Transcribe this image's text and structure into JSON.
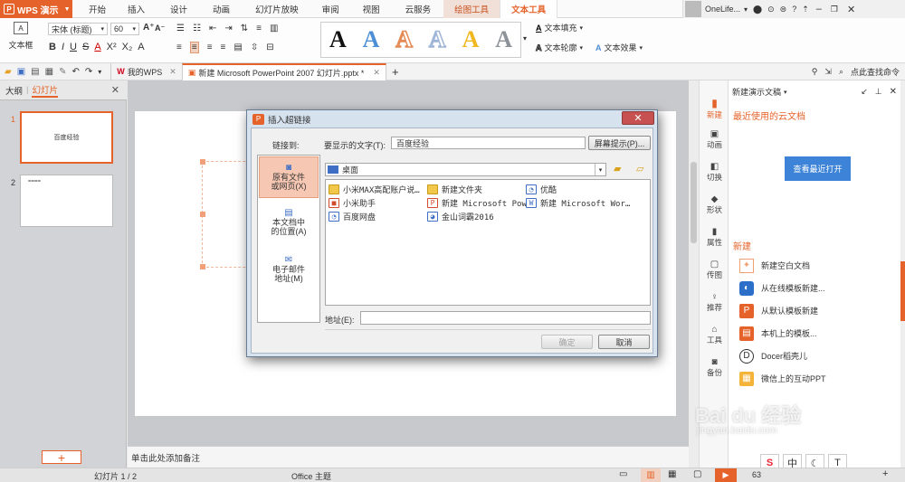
{
  "app": {
    "name": "WPS 演示",
    "logo": "P"
  },
  "menu": {
    "tabs": [
      "开始",
      "插入",
      "设计",
      "动画",
      "幻灯片放映",
      "审阅",
      "视图",
      "云服务",
      "绘图工具",
      "文本工具"
    ],
    "active": "文本工具",
    "context": "绘图工具"
  },
  "account": {
    "name": "OneLife..."
  },
  "ribbon": {
    "textbox": "文本框",
    "font": "宋体 (标题)",
    "size": "60",
    "bold": "B",
    "italic": "I",
    "underline": "U",
    "strike": "S",
    "fill": "文本填充",
    "outline": "文本轮廓",
    "effect": "文本效果",
    "wordart": [
      {
        "letter": "A",
        "color": "#111111"
      },
      {
        "letter": "A",
        "color": "#4d8fd6"
      },
      {
        "letter": "A",
        "color": "#e58a55"
      },
      {
        "letter": "A",
        "color": "#9fb5d8"
      },
      {
        "letter": "A",
        "color": "#f0b81e"
      },
      {
        "letter": "A",
        "color": "#8d9298"
      }
    ]
  },
  "tabs": {
    "home": "我的WPS",
    "doc": "新建 Microsoft PowerPoint 2007 幻灯片.pptx *",
    "search": "点此查找命令"
  },
  "leftpanel": {
    "outline": "大纲",
    "slides": "幻灯片",
    "slide1": "1",
    "slide2": "2",
    "slide1_text": "百度经验",
    "slide2_text": "====",
    "add": "+"
  },
  "notes": "单击此处添加备注",
  "sidebar": [
    {
      "icon": "new-icon",
      "label": "新建"
    },
    {
      "icon": "animation-icon",
      "label": "动画"
    },
    {
      "icon": "transition-icon",
      "label": "切换"
    },
    {
      "icon": "shape-icon",
      "label": "形状"
    },
    {
      "icon": "property-icon",
      "label": "属性"
    },
    {
      "icon": "image-icon",
      "label": "传图"
    },
    {
      "icon": "recommend-icon",
      "label": "推荐"
    },
    {
      "icon": "tools-icon",
      "label": "工具"
    },
    {
      "icon": "backup-icon",
      "label": "备份"
    }
  ],
  "taskpane": {
    "title": "新建演示文稿",
    "recent": "最近使用的云文档",
    "view_recent": "查看最近打开",
    "new_section": "新建",
    "items": [
      "新建空白文档",
      "从在线模板新建...",
      "从默认模板新建",
      "本机上的模板...",
      "Docer稻壳儿",
      "微信上的互动PPT"
    ]
  },
  "status": {
    "slide": "幻灯片 1 / 2",
    "theme": "Office 主题",
    "zoom": "63"
  },
  "ime": [
    "S",
    "中",
    "☾",
    "T"
  ],
  "watermark": {
    "brand": "Bai du 经验",
    "url": "jingyan.baidu.com"
  },
  "dialog": {
    "title": "插入超链接",
    "link_to": "链接到:",
    "display_label": "要显示的文字(T):",
    "display_value": "百度经验",
    "tooltip_btn": "屏幕提示(P)...",
    "options": [
      {
        "label": "原有文件\n或网页(X)",
        "active": true
      },
      {
        "label": "本文档中\n的位置(A)",
        "active": false
      },
      {
        "label": "电子邮件\n地址(M)",
        "active": false
      }
    ],
    "lookin": "桌面",
    "files": [
      {
        "name": "小米MAX高配账户说…",
        "type": "folder"
      },
      {
        "name": "新建文件夹",
        "type": "folder"
      },
      {
        "name": "优酷",
        "type": "sc"
      },
      {
        "name": "小米助手",
        "type": "doc"
      },
      {
        "name": "新建 Microsoft Pow…",
        "type": "doc"
      },
      {
        "name": "新建 Microsoft Wor…",
        "type": "sc"
      },
      {
        "name": "百度网盘",
        "type": "sc"
      },
      {
        "name": "金山词霸2016",
        "type": "sc"
      }
    ],
    "address_label": "地址(E):",
    "address_value": "",
    "ok": "确定",
    "cancel": "取消"
  }
}
